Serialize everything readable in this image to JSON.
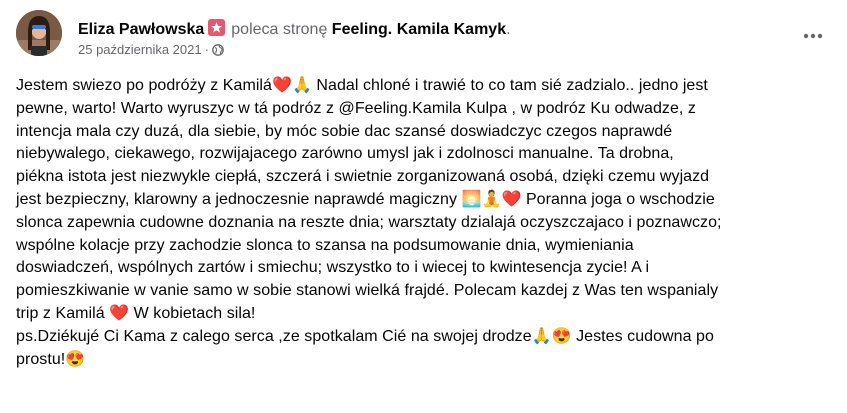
{
  "post": {
    "author": "Eliza Pawłowska",
    "recommends_label": "poleca stronę",
    "page_name": "Feeling. Kamila Kamyk",
    "trailing_punct": ".",
    "date": "25 października 2021",
    "dot": "·",
    "more_icon": "more-dots-icon",
    "badge_icon": "recommend-star-icon",
    "privacy_icon": "globe-icon",
    "accent_color": "#e8566f",
    "body": "Jestem swiezo po podróży z Kamilá❤️🙏 Nadal chloné i trawié to co tam sié zadzialo.. jedno jest\npewne, warto! Warto wyruszyc w tá podróz z @Feeling.Kamila Kulpa , w podróz Ku odwadze, z\nintencja mala czy duzá,  dla siebie, by móc sobie dac szansé doswiadczyc czegos naprawdé\nniebywalego, ciekawego, rozwijajacego zarówno umysl jak i zdolnosci manualne. Ta drobna,\npiékna istota jest niezwykle ciepłá, szczerá i swietnie zorganizowaná osobá, dzięki czemu wyjazd\njest bezpieczny, klarowny a jednoczesnie naprawdé magiczny 🌅🧘❤️ Poranna joga o wschodzie\nslonca zapewnia cudowne doznania na reszte dnia;  warsztaty dzialajá oczyszczajaco i poznawczo;\nwspólne kolacje przy zachodzie slonca to szansa na podsumowanie dnia, wymieniania\ndoswiadczeń, wspólnych zartów i smiechu; wszystko to i wiecej to kwintesencja zycie! A i\npomieszkiwanie  w vanie samo w sobie stanowi wielká frajdé. Polecam kazdej z Was ten wspanialy\ntrip z Kamilá ❤️ W kobietach sila!\nps.Dziékujé Ci Kama z calego serca ,ze spotkalam Cié na swojej drodze🙏😍 Jestes cudowna po\nprostu!😍"
  }
}
